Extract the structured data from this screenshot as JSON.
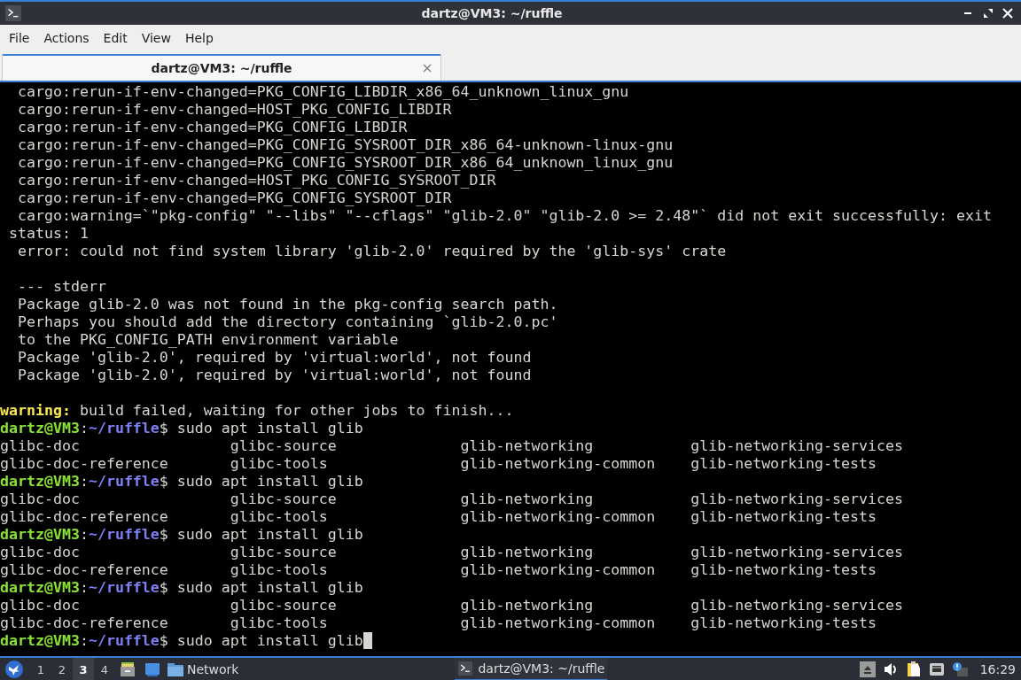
{
  "window": {
    "title": "dartz@VM3: ~/ruffle"
  },
  "menu": [
    "File",
    "Actions",
    "Edit",
    "View",
    "Help"
  ],
  "tabs": [
    {
      "label": "dartz@VM3: ~/ruffle",
      "selected": true
    }
  ],
  "terminal": {
    "lines": [
      {
        "kind": "text",
        "text": "  cargo:rerun-if-env-changed=PKG_CONFIG_LIBDIR_x86_64_unknown_linux_gnu"
      },
      {
        "kind": "text",
        "text": "  cargo:rerun-if-env-changed=HOST_PKG_CONFIG_LIBDIR"
      },
      {
        "kind": "text",
        "text": "  cargo:rerun-if-env-changed=PKG_CONFIG_LIBDIR"
      },
      {
        "kind": "text",
        "text": "  cargo:rerun-if-env-changed=PKG_CONFIG_SYSROOT_DIR_x86_64-unknown-linux-gnu"
      },
      {
        "kind": "text",
        "text": "  cargo:rerun-if-env-changed=PKG_CONFIG_SYSROOT_DIR_x86_64_unknown_linux_gnu"
      },
      {
        "kind": "text",
        "text": "  cargo:rerun-if-env-changed=HOST_PKG_CONFIG_SYSROOT_DIR"
      },
      {
        "kind": "text",
        "text": "  cargo:rerun-if-env-changed=PKG_CONFIG_SYSROOT_DIR"
      },
      {
        "kind": "text",
        "text": "  cargo:warning=`\"pkg-config\" \"--libs\" \"--cflags\" \"glib-2.0\" \"glib-2.0 >= 2.48\"` did not exit successfully: exit"
      },
      {
        "kind": "text",
        "text": " status: 1"
      },
      {
        "kind": "text",
        "text": "  error: could not find system library 'glib-2.0' required by the 'glib-sys' crate"
      },
      {
        "kind": "blank"
      },
      {
        "kind": "text",
        "text": "  --- stderr"
      },
      {
        "kind": "text",
        "text": "  Package glib-2.0 was not found in the pkg-config search path."
      },
      {
        "kind": "text",
        "text": "  Perhaps you should add the directory containing `glib-2.0.pc'"
      },
      {
        "kind": "text",
        "text": "  to the PKG_CONFIG_PATH environment variable"
      },
      {
        "kind": "text",
        "text": "  Package 'glib-2.0', required by 'virtual:world', not found"
      },
      {
        "kind": "text",
        "text": "  Package 'glib-2.0', required by 'virtual:world', not found"
      },
      {
        "kind": "blank"
      },
      {
        "kind": "warning",
        "label": "warning:",
        "text": " build failed, waiting for other jobs to finish..."
      },
      {
        "kind": "prompt",
        "user": "dartz@VM3",
        "separator": ":",
        "path": "~/ruffle",
        "symbol": "$",
        "command": " sudo apt install glib",
        "cursor": false
      },
      {
        "kind": "columns",
        "cells": [
          "glibc-doc",
          "glibc-source",
          "glib-networking",
          "glib-networking-services"
        ]
      },
      {
        "kind": "columns",
        "cells": [
          "glibc-doc-reference",
          "glibc-tools",
          "glib-networking-common",
          "glib-networking-tests"
        ]
      },
      {
        "kind": "prompt",
        "user": "dartz@VM3",
        "separator": ":",
        "path": "~/ruffle",
        "symbol": "$",
        "command": " sudo apt install glib",
        "cursor": false
      },
      {
        "kind": "columns",
        "cells": [
          "glibc-doc",
          "glibc-source",
          "glib-networking",
          "glib-networking-services"
        ]
      },
      {
        "kind": "columns",
        "cells": [
          "glibc-doc-reference",
          "glibc-tools",
          "glib-networking-common",
          "glib-networking-tests"
        ]
      },
      {
        "kind": "prompt",
        "user": "dartz@VM3",
        "separator": ":",
        "path": "~/ruffle",
        "symbol": "$",
        "command": " sudo apt install glib",
        "cursor": false
      },
      {
        "kind": "columns",
        "cells": [
          "glibc-doc",
          "glibc-source",
          "glib-networking",
          "glib-networking-services"
        ]
      },
      {
        "kind": "columns",
        "cells": [
          "glibc-doc-reference",
          "glibc-tools",
          "glib-networking-common",
          "glib-networking-tests"
        ]
      },
      {
        "kind": "prompt",
        "user": "dartz@VM3",
        "separator": ":",
        "path": "~/ruffle",
        "symbol": "$",
        "command": " sudo apt install glib",
        "cursor": false
      },
      {
        "kind": "columns",
        "cells": [
          "glibc-doc",
          "glibc-source",
          "glib-networking",
          "glib-networking-services"
        ]
      },
      {
        "kind": "columns",
        "cells": [
          "glibc-doc-reference",
          "glibc-tools",
          "glib-networking-common",
          "glib-networking-tests"
        ]
      },
      {
        "kind": "prompt",
        "user": "dartz@VM3",
        "separator": ":",
        "path": "~/ruffle",
        "symbol": "$",
        "command": " sudo apt install glib",
        "cursor": true
      }
    ]
  },
  "taskbar": {
    "workspaces": [
      {
        "label": "1",
        "selected": false
      },
      {
        "label": "2",
        "selected": false
      },
      {
        "label": "3",
        "selected": true
      },
      {
        "label": "4",
        "selected": false
      }
    ],
    "folder_label": "Network",
    "tasks": [
      {
        "label": "dartz@VM3: ~/ruffle",
        "selected": true
      }
    ],
    "clock": "16:29"
  }
}
